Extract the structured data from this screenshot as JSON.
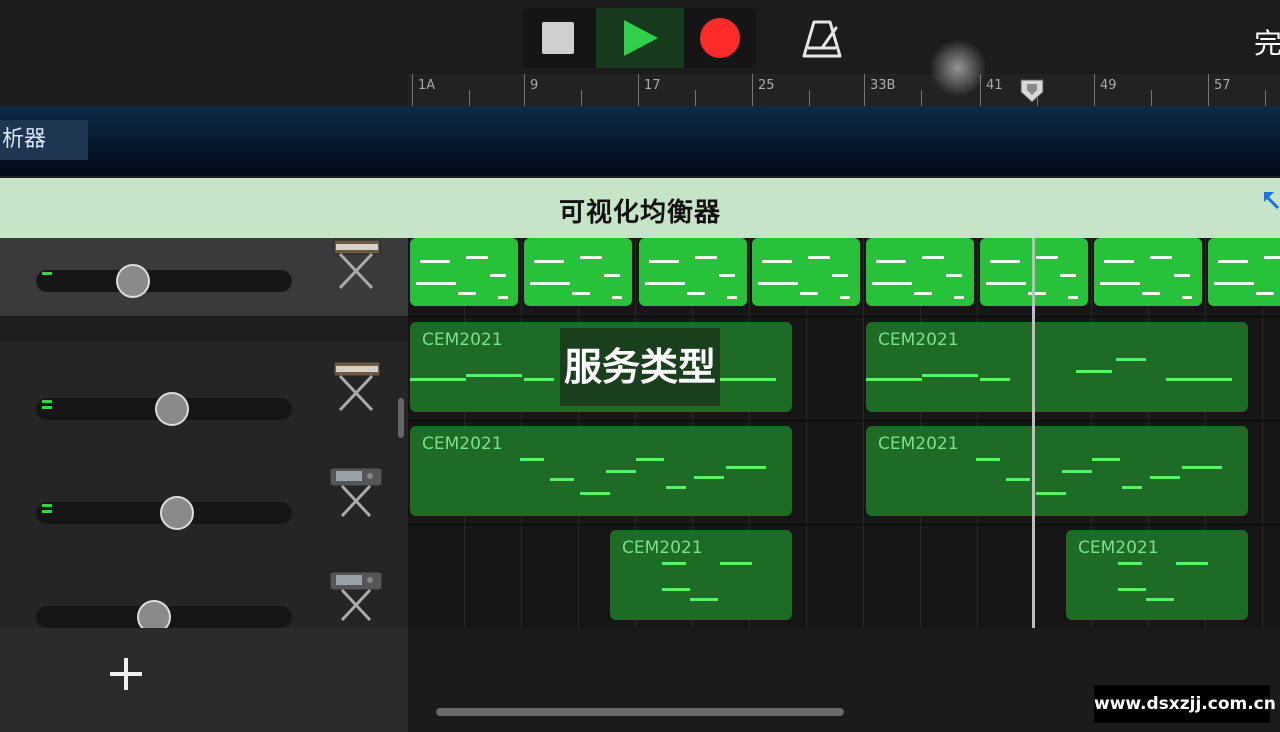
{
  "toolbar": {
    "stop_icon": "stop-icon",
    "play_icon": "play-icon",
    "record_icon": "record-icon",
    "metronome_icon": "metronome-icon",
    "done_label": "完",
    "colors": {
      "play": "#2fd04a",
      "record": "#ff2a2a"
    }
  },
  "ruler": {
    "bars": [
      "1A",
      "9",
      "17",
      "25",
      "33B",
      "41",
      "49",
      "57"
    ],
    "playhead_bar": 41
  },
  "analyzer": {
    "tab_label": "析器"
  },
  "eq": {
    "title": "可视化均衡器",
    "expand_icon": "expand-icon"
  },
  "tracks": [
    {
      "instrument_icon": "synth-keyboard-icon",
      "volume": 0.38,
      "selected": true
    },
    {
      "instrument_icon": "synth-keyboard-icon",
      "volume": 0.53,
      "selected": false
    },
    {
      "instrument_icon": "drum-machine-icon",
      "volume": 0.55,
      "selected": false
    },
    {
      "instrument_icon": "drum-machine-icon",
      "volume": 0.46,
      "selected": false
    }
  ],
  "regions": {
    "name": "CEM2021"
  },
  "add_track_icon": "plus-icon",
  "overlay": {
    "text": "服务类型"
  },
  "watermark": {
    "text": "www.dsxzjj.com.cn"
  }
}
